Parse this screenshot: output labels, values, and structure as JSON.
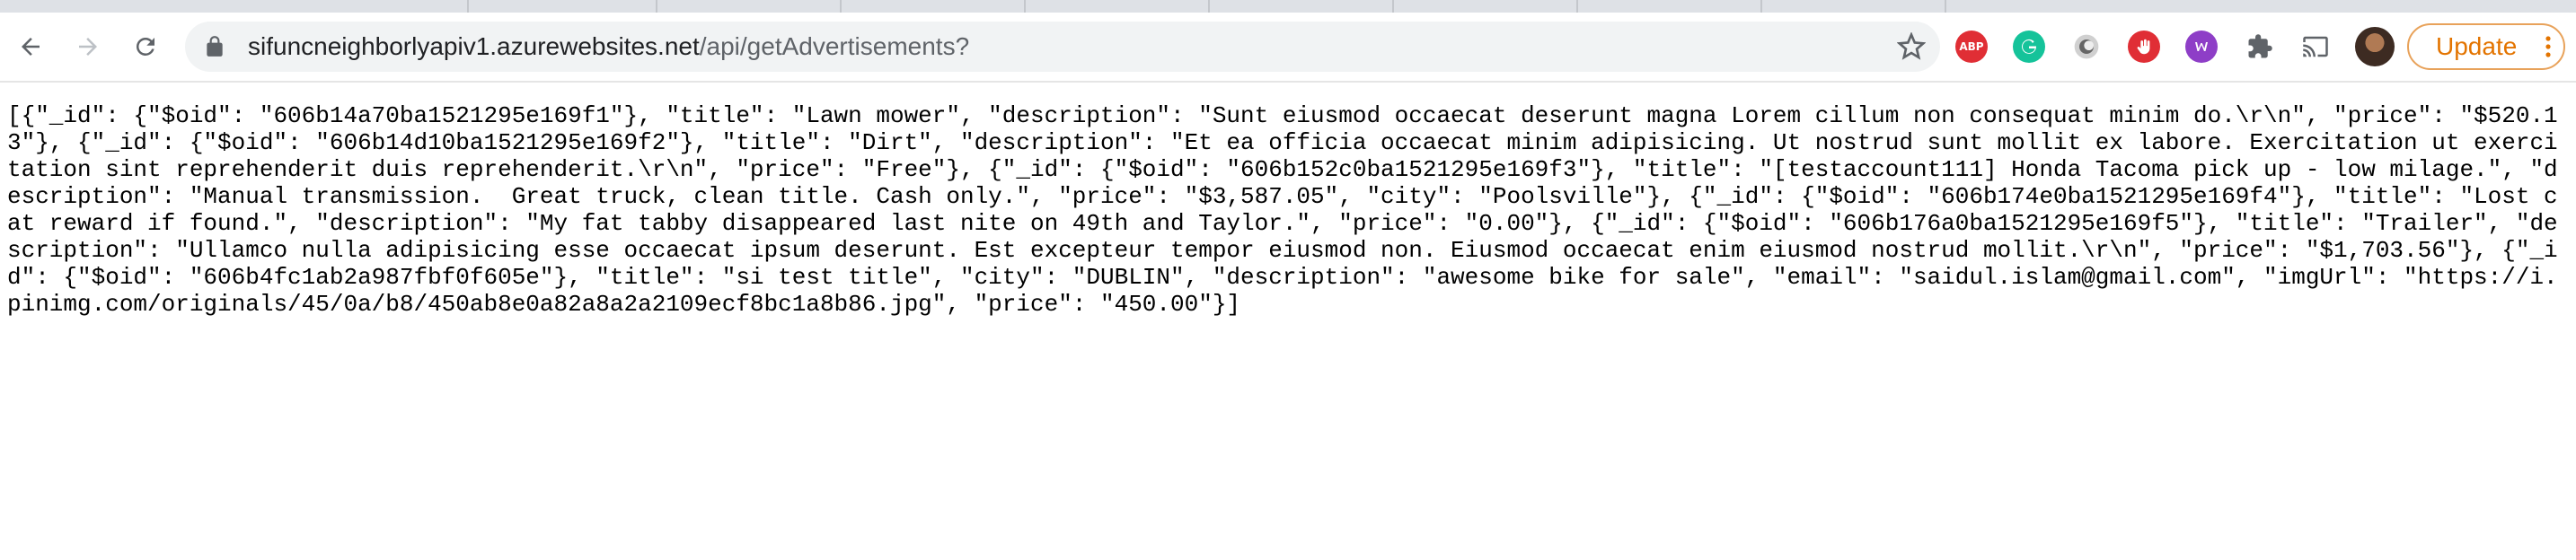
{
  "browser": {
    "url_host": "sifuncneighborlyapiv1.azurewebsites.net",
    "url_path": "/api/getAdvertisements?",
    "update_label": "Update",
    "extensions": [
      {
        "name": "adblock-plus-icon",
        "text": "ABP",
        "color": "#e02e35"
      },
      {
        "name": "grammarly-icon",
        "text": "",
        "color": "#15c39a"
      },
      {
        "name": "circle-extension-icon",
        "text": "",
        "color": "#8a8a8a"
      },
      {
        "name": "hand-stop-icon",
        "text": "",
        "color": "#e02e35"
      },
      {
        "name": "purple-w-icon",
        "text": "",
        "color": "#8e3ec7"
      }
    ]
  },
  "page": {
    "body_text": "[{\"_id\": {\"$oid\": \"606b14a70ba1521295e169f1\"}, \"title\": \"Lawn mower\", \"description\": \"Sunt eiusmod occaecat deserunt magna Lorem cillum non consequat minim do.\\r\\n\", \"price\": \"$520.13\"}, {\"_id\": {\"$oid\": \"606b14d10ba1521295e169f2\"}, \"title\": \"Dirt\", \"description\": \"Et ea officia occaecat minim adipisicing. Ut nostrud sunt mollit ex labore. Exercitation ut exercitation sint reprehenderit duis reprehenderit.\\r\\n\", \"price\": \"Free\"}, {\"_id\": {\"$oid\": \"606b152c0ba1521295e169f3\"}, \"title\": \"[testaccount111] Honda Tacoma pick up - low milage.\", \"description\": \"Manual transmission.  Great truck, clean title. Cash only.\", \"price\": \"$3,587.05\", \"city\": \"Poolsville\"}, {\"_id\": {\"$oid\": \"606b174e0ba1521295e169f4\"}, \"title\": \"Lost cat reward if found.\", \"description\": \"My fat tabby disappeared last nite on 49th and Taylor.\", \"price\": \"0.00\"}, {\"_id\": {\"$oid\": \"606b176a0ba1521295e169f5\"}, \"title\": \"Trailer\", \"description\": \"Ullamco nulla adipisicing esse occaecat ipsum deserunt. Est excepteur tempor eiusmod non. Eiusmod occaecat enim eiusmod nostrud mollit.\\r\\n\", \"price\": \"$1,703.56\"}, {\"_id\": {\"$oid\": \"606b4fc1ab2a987fbf0f605e\"}, \"title\": \"si test title\", \"city\": \"DUBLIN\", \"description\": \"awesome bike for sale\", \"email\": \"saidul.islam@gmail.com\", \"imgUrl\": \"https://i.pinimg.com/originals/45/0a/b8/450ab8e0a82a8a2a2109ecf8bc1a8b86.jpg\", \"price\": \"450.00\"}]"
  }
}
